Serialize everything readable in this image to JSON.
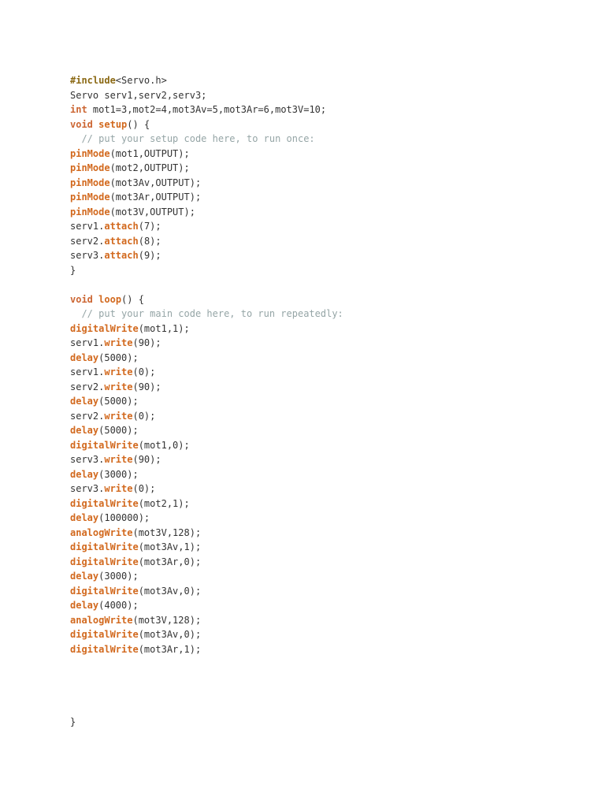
{
  "document": {
    "colors": {
      "text": "#333333",
      "keyword": "#d2691e",
      "preprocessor": "#8b6914",
      "comment": "#95a5a6"
    },
    "lines": [
      [
        {
          "t": "#include",
          "k": "pre"
        },
        {
          "t": "<Servo.h>",
          "k": "default"
        }
      ],
      [
        {
          "t": "Servo serv1,serv2,serv3;",
          "k": "default"
        }
      ],
      [
        {
          "t": "int",
          "k": "type"
        },
        {
          "t": " mot1=3,mot2=4,mot3Av=5,mot3Ar=6,mot3V=10;",
          "k": "default"
        }
      ],
      [
        {
          "t": "void",
          "k": "type"
        },
        {
          "t": " ",
          "k": "default"
        },
        {
          "t": "setup",
          "k": "fn"
        },
        {
          "t": "() {",
          "k": "default"
        }
      ],
      [
        {
          "t": "  // put your setup code here, to run once:",
          "k": "comment"
        }
      ],
      [
        {
          "t": "pinMode",
          "k": "fn"
        },
        {
          "t": "(mot1,OUTPUT);",
          "k": "default"
        }
      ],
      [
        {
          "t": "pinMode",
          "k": "fn"
        },
        {
          "t": "(mot2,OUTPUT);",
          "k": "default"
        }
      ],
      [
        {
          "t": "pinMode",
          "k": "fn"
        },
        {
          "t": "(mot3Av,OUTPUT);",
          "k": "default"
        }
      ],
      [
        {
          "t": "pinMode",
          "k": "fn"
        },
        {
          "t": "(mot3Ar,OUTPUT);",
          "k": "default"
        }
      ],
      [
        {
          "t": "pinMode",
          "k": "fn"
        },
        {
          "t": "(mot3V,OUTPUT);",
          "k": "default"
        }
      ],
      [
        {
          "t": "serv1.",
          "k": "default"
        },
        {
          "t": "attach",
          "k": "fn"
        },
        {
          "t": "(7);",
          "k": "default"
        }
      ],
      [
        {
          "t": "serv2.",
          "k": "default"
        },
        {
          "t": "attach",
          "k": "fn"
        },
        {
          "t": "(8);",
          "k": "default"
        }
      ],
      [
        {
          "t": "serv3.",
          "k": "default"
        },
        {
          "t": "attach",
          "k": "fn"
        },
        {
          "t": "(9);",
          "k": "default"
        }
      ],
      [
        {
          "t": "}",
          "k": "default"
        }
      ],
      [],
      [
        {
          "t": "void",
          "k": "type"
        },
        {
          "t": " ",
          "k": "default"
        },
        {
          "t": "loop",
          "k": "fn"
        },
        {
          "t": "() {",
          "k": "default"
        }
      ],
      [
        {
          "t": "  // put your main code here, to run repeatedly:",
          "k": "comment"
        }
      ],
      [
        {
          "t": "digitalWrite",
          "k": "fn"
        },
        {
          "t": "(mot1,1);",
          "k": "default"
        }
      ],
      [
        {
          "t": "serv1.",
          "k": "default"
        },
        {
          "t": "write",
          "k": "fn"
        },
        {
          "t": "(90);",
          "k": "default"
        }
      ],
      [
        {
          "t": "delay",
          "k": "fn"
        },
        {
          "t": "(5000);",
          "k": "default"
        }
      ],
      [
        {
          "t": "serv1.",
          "k": "default"
        },
        {
          "t": "write",
          "k": "fn"
        },
        {
          "t": "(0);",
          "k": "default"
        }
      ],
      [
        {
          "t": "serv2.",
          "k": "default"
        },
        {
          "t": "write",
          "k": "fn"
        },
        {
          "t": "(90);",
          "k": "default"
        }
      ],
      [
        {
          "t": "delay",
          "k": "fn"
        },
        {
          "t": "(5000);",
          "k": "default"
        }
      ],
      [
        {
          "t": "serv2.",
          "k": "default"
        },
        {
          "t": "write",
          "k": "fn"
        },
        {
          "t": "(0);",
          "k": "default"
        }
      ],
      [
        {
          "t": "delay",
          "k": "fn"
        },
        {
          "t": "(5000);",
          "k": "default"
        }
      ],
      [
        {
          "t": "digitalWrite",
          "k": "fn"
        },
        {
          "t": "(mot1,0);",
          "k": "default"
        }
      ],
      [
        {
          "t": "serv3.",
          "k": "default"
        },
        {
          "t": "write",
          "k": "fn"
        },
        {
          "t": "(90);",
          "k": "default"
        }
      ],
      [
        {
          "t": "delay",
          "k": "fn"
        },
        {
          "t": "(3000);",
          "k": "default"
        }
      ],
      [
        {
          "t": "serv3.",
          "k": "default"
        },
        {
          "t": "write",
          "k": "fn"
        },
        {
          "t": "(0);",
          "k": "default"
        }
      ],
      [
        {
          "t": "digitalWrite",
          "k": "fn"
        },
        {
          "t": "(mot2,1);",
          "k": "default"
        }
      ],
      [
        {
          "t": "delay",
          "k": "fn"
        },
        {
          "t": "(100000);",
          "k": "default"
        }
      ],
      [
        {
          "t": "analogWrite",
          "k": "fn"
        },
        {
          "t": "(mot3V,128);",
          "k": "default"
        }
      ],
      [
        {
          "t": "digitalWrite",
          "k": "fn"
        },
        {
          "t": "(mot3Av,1);",
          "k": "default"
        }
      ],
      [
        {
          "t": "digitalWrite",
          "k": "fn"
        },
        {
          "t": "(mot3Ar,0);",
          "k": "default"
        }
      ],
      [
        {
          "t": "delay",
          "k": "fn"
        },
        {
          "t": "(3000);",
          "k": "default"
        }
      ],
      [
        {
          "t": "digitalWrite",
          "k": "fn"
        },
        {
          "t": "(mot3Av,0);",
          "k": "default"
        }
      ],
      [
        {
          "t": "delay",
          "k": "fn"
        },
        {
          "t": "(4000);",
          "k": "default"
        }
      ],
      [
        {
          "t": "analogWrite",
          "k": "fn"
        },
        {
          "t": "(mot3V,128);",
          "k": "default"
        }
      ],
      [
        {
          "t": "digitalWrite",
          "k": "fn"
        },
        {
          "t": "(mot3Av,0);",
          "k": "default"
        }
      ],
      [
        {
          "t": "digitalWrite",
          "k": "fn"
        },
        {
          "t": "(mot3Ar,1);",
          "k": "default"
        }
      ],
      [],
      [],
      [],
      [],
      [
        {
          "t": "}",
          "k": "default"
        }
      ]
    ]
  }
}
